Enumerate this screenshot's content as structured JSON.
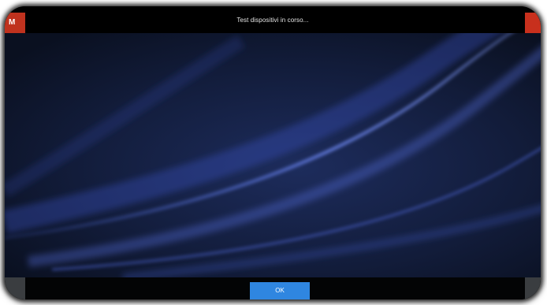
{
  "window": {
    "title": "Test dispositivi in corso..."
  },
  "corner_left_glyph": "M",
  "dialog": {
    "ok_label": "OK"
  },
  "colors": {
    "accent": "#2f86e0",
    "close_red": "#c8301d",
    "wallpaper_base": "#0c1428"
  },
  "icons": {
    "top_left": "app-badge-icon",
    "top_right": "close-icon"
  }
}
